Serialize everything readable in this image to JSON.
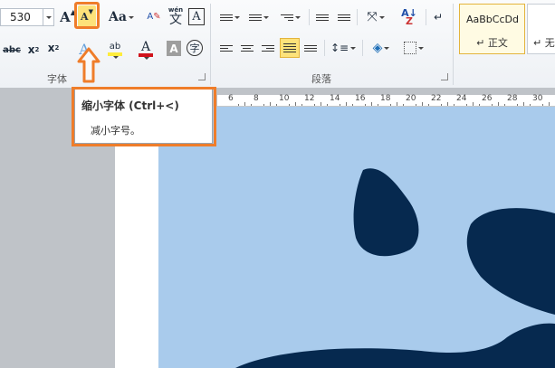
{
  "ribbon": {
    "font_group": {
      "label": "字体",
      "font_size": "530",
      "grow_font_glyph": "A",
      "shrink_font_glyph": "A",
      "change_case_label": "Aa",
      "pinyin_glyph": "文",
      "pinyin_top": "wén",
      "char_border_glyph": "A",
      "strikethrough_label": "abc",
      "subscript_label": "x",
      "subscript_sub": "2",
      "superscript_label": "x",
      "superscript_sup": "2",
      "text_effect_glyph": "A",
      "highlight_label": "ab",
      "font_color_glyph": "A",
      "char_shading_glyph": "A",
      "enclose_char_glyph": "字"
    },
    "paragraph_group": {
      "label": "段落"
    },
    "styles_group": {
      "style1_preview": "AaBbCcDd",
      "style1_name": "↵ 正文",
      "style2_name": "↵ 无"
    }
  },
  "tooltip": {
    "title": "缩小字体 (Ctrl+<)",
    "description": "减小字号。"
  },
  "ruler": {
    "numbers": [
      "6",
      "8",
      "10",
      "12",
      "14",
      "16",
      "18",
      "20",
      "22",
      "24",
      "26",
      "28",
      "30"
    ]
  },
  "colors": {
    "highlight_orange": "#ef7d2a",
    "arrow_fill": "#f9f9f9",
    "page_blue": "#a9cbec",
    "shape_navy": "#06294f",
    "highlight_yellow": "#ffec3d",
    "font_red": "#d0121b"
  }
}
